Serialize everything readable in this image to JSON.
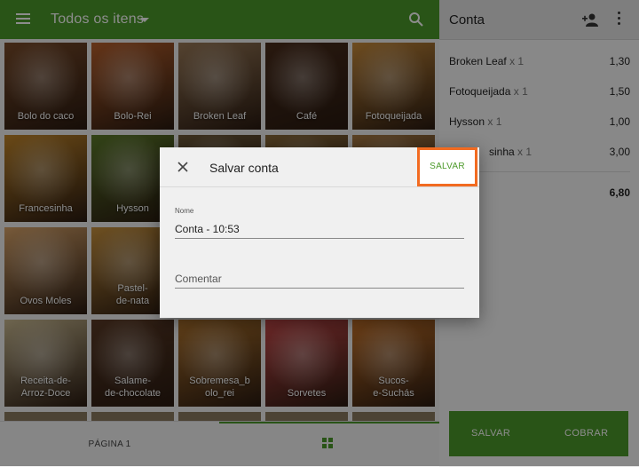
{
  "header": {
    "title": "Todos os itens",
    "icons": [
      "menu-icon",
      "chevron-down-icon",
      "search-icon"
    ]
  },
  "tiles": [
    {
      "label": "Bolo do caco",
      "color": "#7a4b2a"
    },
    {
      "label": "Bolo-Rei",
      "color": "#b8602c"
    },
    {
      "label": "Broken Leaf",
      "color": "#9a7a58"
    },
    {
      "label": "Café",
      "color": "#4a2d1c"
    },
    {
      "label": "Fotoqueijada",
      "color": "#c88b3c"
    },
    {
      "label": "Francesinha",
      "color": "#c2862a"
    },
    {
      "label": "Hysson",
      "color": "#5c7a2a"
    },
    {
      "label": "",
      "color": "#6f5a3a"
    },
    {
      "label": "",
      "color": "#8a6a3a"
    },
    {
      "label": "",
      "color": "#a87a44"
    },
    {
      "label": "Ovos Moles",
      "color": "#d9a46a"
    },
    {
      "label": "Pastel-\nde-nata",
      "color": "#c9923e"
    },
    {
      "label": "",
      "color": "#b08a5a"
    },
    {
      "label": "",
      "color": "#9a6a3a"
    },
    {
      "label": "",
      "color": "#a0744a"
    },
    {
      "label": "Receita-de-\nArroz-Doce",
      "color": "#c8b890"
    },
    {
      "label": "Salame-\nde-chocolate",
      "color": "#5a3a26"
    },
    {
      "label": "Sobremesa_b\nolo_rei",
      "color": "#b2752e"
    },
    {
      "label": "Sorvetes",
      "color": "#c84a4a"
    },
    {
      "label": "Sucos-\ne-Suchás",
      "color": "#c8742a"
    }
  ],
  "footer": {
    "page_label": "PÁGINA 1",
    "view_icon": "grid-icon"
  },
  "account": {
    "title": "Conta",
    "icons": [
      "add-person-icon",
      "more-vert-icon"
    ],
    "lines": [
      {
        "name": "Broken Leaf",
        "qty": "x 1",
        "price": "1,30"
      },
      {
        "name": "Fotoqueijada",
        "qty": "x 1",
        "price": "1,50"
      },
      {
        "name": "Hysson",
        "qty": "x 1",
        "price": "1,00"
      },
      {
        "name": "sinha",
        "qty": "x 1",
        "price": "3,00"
      }
    ],
    "total": "6,80",
    "save_label": "SALVAR",
    "charge_label": "COBRAR"
  },
  "dialog": {
    "title": "Salvar conta",
    "save_label": "SALVAR",
    "name_label": "Nome",
    "name_value": "Conta - 10:53",
    "comment_placeholder": "Comentar",
    "highlight_color": "#f26b21"
  },
  "colors": {
    "primary": "#4c9a2a"
  }
}
